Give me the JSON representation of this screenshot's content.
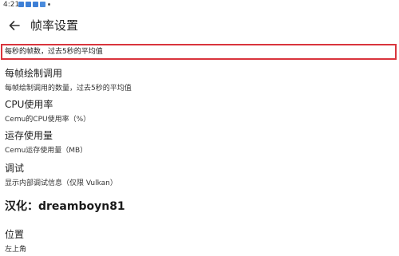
{
  "status_bar": {
    "time": "4:21",
    "icons": [
      "notification-icon",
      "notification-icon",
      "notification-icon",
      "notification-icon",
      "dot-icon"
    ]
  },
  "app_bar": {
    "title": "帧率设置",
    "back_icon": "arrow-left-icon"
  },
  "highlighted_row": {
    "text": "每秒的帧数，过去5秒的平均值",
    "border_color": "#d9343c"
  },
  "settings": [
    {
      "title": "每帧绘制调用",
      "summary": "每帧绘制调用的数量，过去5秒的平均值"
    },
    {
      "title": "CPU使用率",
      "summary": "Cemu的CPU使用率（%）"
    },
    {
      "title": "运存使用量",
      "summary": "Cemu运存使用量（MB）"
    },
    {
      "title": "调试",
      "summary": "显示内部调试信息（仅限 Vulkan）"
    }
  ],
  "credit": "汉化：dreamboyn81",
  "position_setting": {
    "title": "位置",
    "summary": "左上角"
  }
}
